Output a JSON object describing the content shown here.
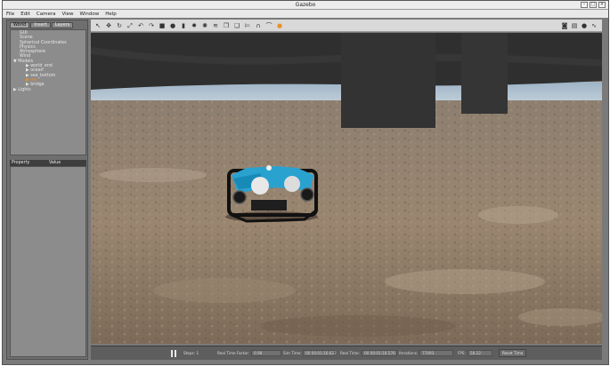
{
  "window": {
    "title": "Gazebo",
    "controls": [
      "–",
      "□",
      "×"
    ]
  },
  "menu": [
    "File",
    "Edit",
    "Camera",
    "View",
    "Window",
    "Help"
  ],
  "panel": {
    "tabs": [
      "World",
      "Insert",
      "Layers"
    ],
    "tree": [
      {
        "label": "GUI",
        "indent": 1,
        "selected": false
      },
      {
        "label": "Scene",
        "indent": 1,
        "selected": false
      },
      {
        "label": "Spherical Coordinates",
        "indent": 1,
        "selected": false
      },
      {
        "label": "Physics",
        "indent": 1,
        "selected": false
      },
      {
        "label": "Atmosphere",
        "indent": 1,
        "selected": false
      },
      {
        "label": "Wind",
        "indent": 1,
        "selected": false
      },
      {
        "label": "▼ Models",
        "indent": 0,
        "selected": false
      },
      {
        "label": "▶ world_end",
        "indent": 2,
        "selected": false
      },
      {
        "label": "▶ ocean",
        "indent": 2,
        "selected": false
      },
      {
        "label": "▶ sea_bottom",
        "indent": 2,
        "selected": false
      },
      {
        "label": "▶ rov",
        "indent": 2,
        "selected": true
      },
      {
        "label": "▶ bridge",
        "indent": 2,
        "selected": false
      },
      {
        "label": "▶ Lights",
        "indent": 0,
        "selected": false
      }
    ],
    "props_header": {
      "property": "Property",
      "value": "Value"
    }
  },
  "toolbar": {
    "left": [
      "select-arrow",
      "translate",
      "rotate",
      "scale",
      "undo",
      "redo",
      "box",
      "sphere",
      "cylinder",
      "point-light",
      "spot-light",
      "directional-light",
      "copy",
      "paste",
      "align",
      "snap",
      "joint",
      "orange-indicator"
    ],
    "left_glyphs": [
      "↖",
      "✥",
      "↻",
      "⤢",
      "↶",
      "↷",
      "■",
      "●",
      "▮",
      "✹",
      "✺",
      "≋",
      "❐",
      "❏",
      "⊨",
      "∩",
      "⌒",
      "●"
    ],
    "right": [
      "screenshot",
      "log",
      "record",
      "plot"
    ],
    "right_glyphs": [
      "◙",
      "▤",
      "●",
      "∿"
    ]
  },
  "status": {
    "steps_label": "Steps: 1",
    "rtf_label": "Real Time Factor:",
    "rtf_value": "0.98",
    "sim_label": "Sim Time:",
    "sim_value": "00 00:01:16.622",
    "real_label": "Real Time:",
    "real_value": "00 00:01:18.576",
    "iter_label": "Iterations:",
    "iter_value": "77093",
    "fps_label": "FPS:",
    "fps_value": "58.22",
    "reset_label": "Reset Time"
  },
  "colors": {
    "orange": "#e8902e",
    "rov_blue": "#2aa2d0",
    "sky": "#aec3d6",
    "ceiling": "#2f2f2f"
  }
}
